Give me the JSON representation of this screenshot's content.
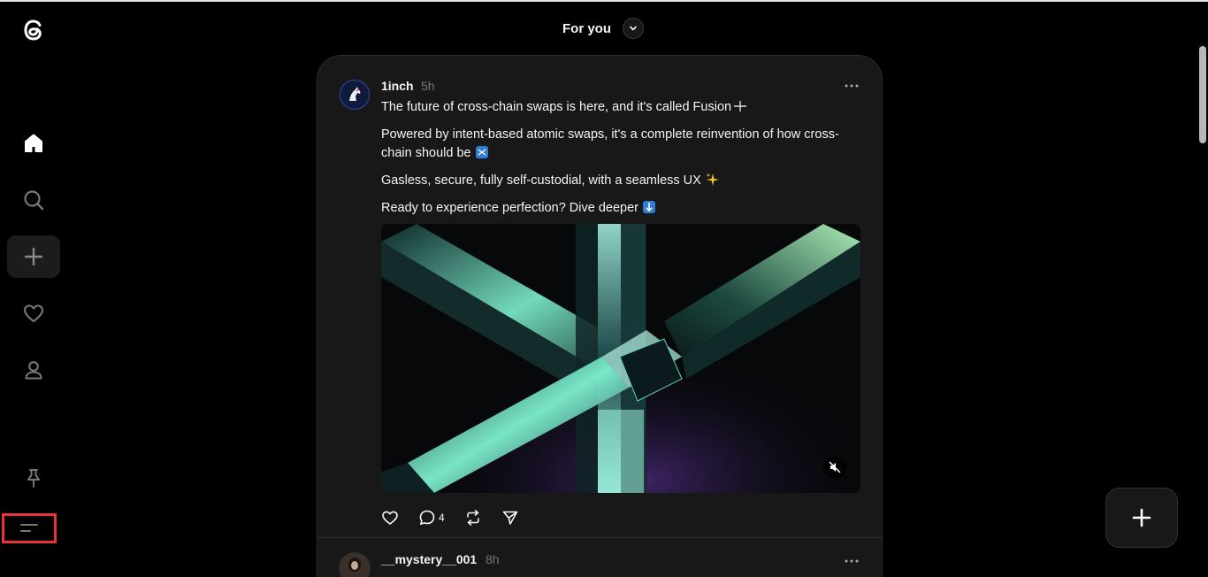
{
  "feed": {
    "title": "For you"
  },
  "sidebar": {
    "items": [
      {
        "name": "home",
        "icon": "home-icon"
      },
      {
        "name": "search",
        "icon": "search-icon"
      },
      {
        "name": "create",
        "icon": "plus-icon"
      },
      {
        "name": "activity",
        "icon": "heart-icon"
      },
      {
        "name": "profile",
        "icon": "person-icon"
      },
      {
        "name": "pinned",
        "icon": "pin-icon"
      },
      {
        "name": "more",
        "icon": "menu-icon"
      }
    ]
  },
  "posts": [
    {
      "username": "1inch",
      "time": "5h",
      "paragraphs": [
        "The future of cross-chain swaps is here, and it's called Fusion",
        "Powered by intent-based atomic swaps, it's a complete reinvention of how cross-chain should be",
        "Gasless, secure, fully self-custodial, with a seamless UX",
        "Ready to experience perfection? Dive deeper"
      ],
      "reply_count": "4"
    },
    {
      "username": "__mystery__001",
      "time": "8h"
    }
  ],
  "colors": {
    "background": "#000000",
    "card": "#181818",
    "border": "#2d2d2d",
    "text": "#f3f5f7",
    "muted": "#777777",
    "highlight_box": "#e8323c",
    "emoji_blue": "#2f7fd8"
  }
}
